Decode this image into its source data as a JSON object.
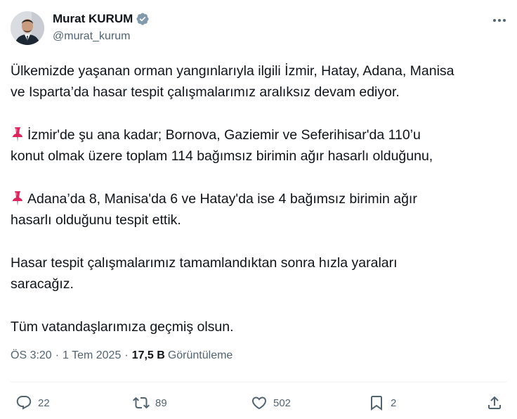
{
  "author": {
    "name": "Murat KURUM",
    "handle": "@murat_kurum",
    "verified_color": "#829aab"
  },
  "tweet": {
    "paragraphs": [
      {
        "pin": false,
        "text": "Ülkemizde yaşanan orman yangınlarıyla ilgili İzmir, Hatay, Adana, Manisa\nve Isparta’da hasar tespit çalışmalarımız aralıksız devam ediyor."
      },
      {
        "pin": true,
        "text": "İzmir'de şu ana kadar; Bornova, Gaziemir ve Seferihisar'da 110’u\nkonut olmak üzere toplam 114 bağımsız birimin ağır hasarlı olduğunu,"
      },
      {
        "pin": true,
        "text": "Adana’da 8, Manisa'da 6 ve Hatay'da ise 4 bağımsız birimin ağır\nhasarlı olduğunu tespit ettik."
      },
      {
        "pin": false,
        "text": "Hasar tespit çalışmalarımız tamamlandıktan sonra hızla yaraları\nsaracağız."
      },
      {
        "pin": false,
        "text": "Tüm vatandaşlarımıza geçmiş olsun."
      }
    ]
  },
  "meta": {
    "time": "ÖS 3:20",
    "separator": "·",
    "date": "1 Tem 2025",
    "views_count": "17,5 B",
    "views_label": "Görüntüleme"
  },
  "actions": {
    "replies": "22",
    "reposts": "89",
    "likes": "502",
    "bookmarks": "2"
  },
  "colors": {
    "text": "#0f1419",
    "secondary": "#536471",
    "divider": "#eff3f4",
    "pin_red": "#e0245e"
  }
}
